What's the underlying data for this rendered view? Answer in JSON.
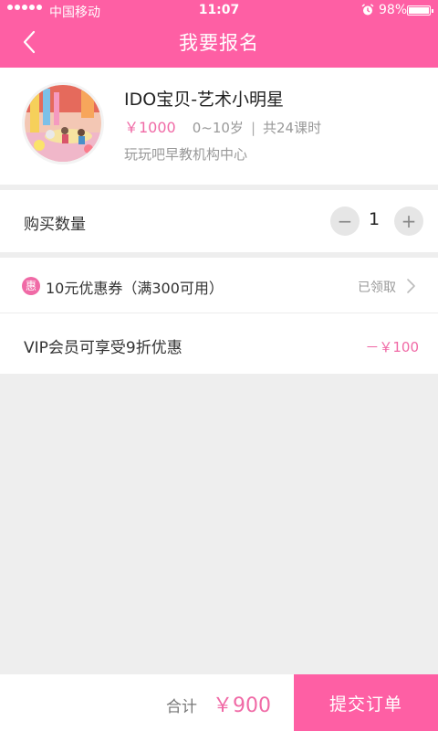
{
  "status_bar": {
    "carrier": "中国移动",
    "time": "11:07",
    "battery": "98%"
  },
  "nav": {
    "title": "我要报名",
    "back_icon": "chevron-left-icon"
  },
  "course": {
    "name": "IDO宝贝-艺术小明星",
    "price": "￥1000",
    "age_range": "0~10岁",
    "separator": "|",
    "lessons": "共24课时",
    "organization": "玩玩吧早教机构中心",
    "thumbnail_icon": "course-photo"
  },
  "quantity": {
    "label": "购买数量",
    "minus": "−",
    "value": "1",
    "plus": "+"
  },
  "coupon": {
    "badge": "惠",
    "text": "10元优惠券（满300可用）",
    "status": "已领取"
  },
  "vip": {
    "text": "VIP会员可享受9折优惠",
    "discount": "－￥100"
  },
  "footer": {
    "total_label": "合计",
    "total_amount": "￥900",
    "submit_label": "提交订单"
  },
  "colors": {
    "brand_pink": "#fe5fa4",
    "accent_pink": "#f06aa6",
    "background": "#eeeeee"
  }
}
